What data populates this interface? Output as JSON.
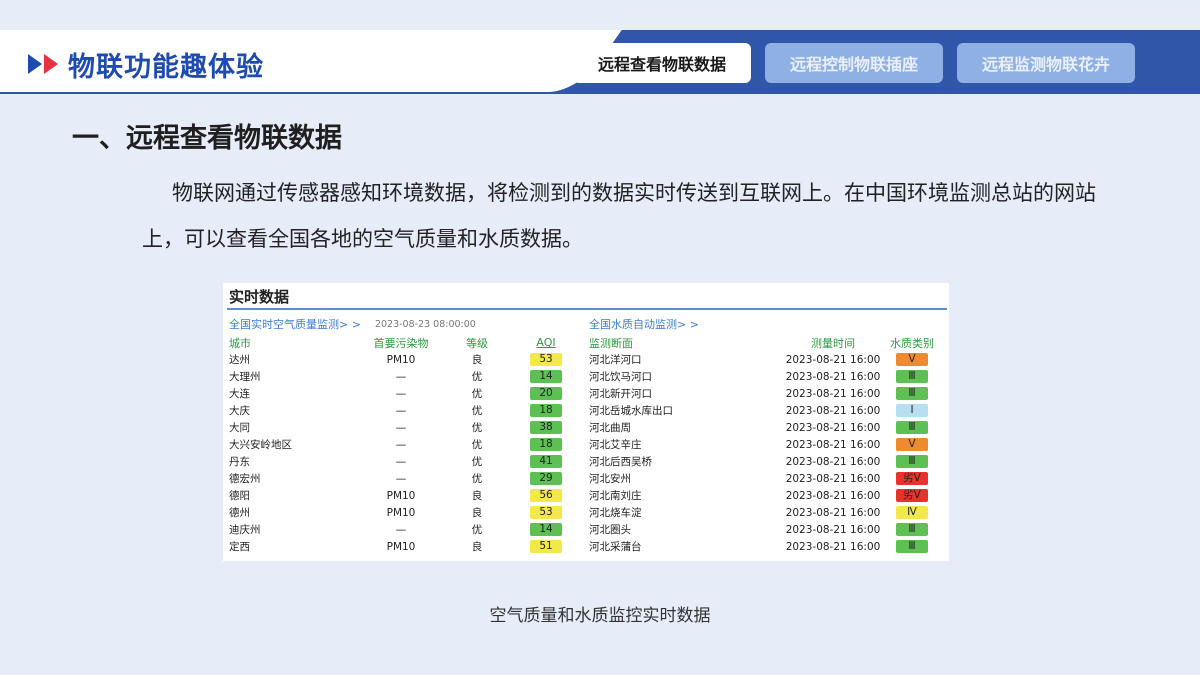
{
  "header": {
    "title": "物联功能趣体验",
    "tabs": [
      {
        "label": "远程查看物联数据",
        "active": true
      },
      {
        "label": "远程控制物联插座",
        "active": false
      },
      {
        "label": "远程监测物联花卉",
        "active": false
      }
    ]
  },
  "section": {
    "title": "一、远程查看物联数据",
    "paragraph": "物联网通过传感器感知环境数据，将检测到的数据实时传送到互联网上。在中国环境监测总站的网站上，可以查看全国各地的空气质量和水质数据。"
  },
  "panel": {
    "title": "实时数据",
    "air": {
      "link": "全国实时空气质量监测> >",
      "timestamp": "2023-08-23 08:00:00",
      "headers": {
        "city": "城市",
        "pollutant": "首要污染物",
        "level": "等级",
        "aqi": "AQI"
      },
      "rows": [
        {
          "city": "达州",
          "pollutant": "PM10",
          "level": "良",
          "aqi": "53",
          "color": "#f2e84a"
        },
        {
          "city": "大理州",
          "pollutant": "—",
          "level": "优",
          "aqi": "14",
          "color": "#5cc152"
        },
        {
          "city": "大连",
          "pollutant": "—",
          "level": "优",
          "aqi": "20",
          "color": "#5cc152"
        },
        {
          "city": "大庆",
          "pollutant": "—",
          "level": "优",
          "aqi": "18",
          "color": "#5cc152"
        },
        {
          "city": "大同",
          "pollutant": "—",
          "level": "优",
          "aqi": "38",
          "color": "#5cc152"
        },
        {
          "city": "大兴安岭地区",
          "pollutant": "—",
          "level": "优",
          "aqi": "18",
          "color": "#5cc152"
        },
        {
          "city": "丹东",
          "pollutant": "—",
          "level": "优",
          "aqi": "41",
          "color": "#5cc152"
        },
        {
          "city": "德宏州",
          "pollutant": "—",
          "level": "优",
          "aqi": "29",
          "color": "#5cc152"
        },
        {
          "city": "德阳",
          "pollutant": "PM10",
          "level": "良",
          "aqi": "56",
          "color": "#f2e84a"
        },
        {
          "city": "德州",
          "pollutant": "PM10",
          "level": "良",
          "aqi": "53",
          "color": "#f2e84a"
        },
        {
          "city": "迪庆州",
          "pollutant": "—",
          "level": "优",
          "aqi": "14",
          "color": "#5cc152"
        },
        {
          "city": "定西",
          "pollutant": "PM10",
          "level": "良",
          "aqi": "51",
          "color": "#f2e84a"
        }
      ]
    },
    "water": {
      "link": "全国水质自动监测> >",
      "headers": {
        "site": "监测断面",
        "time": "测量时间",
        "class": "水质类别"
      },
      "rows": [
        {
          "site": "河北洋河口",
          "time": "2023-08-21 16:00",
          "class": "Ⅴ",
          "color": "#f08a2e"
        },
        {
          "site": "河北饮马河口",
          "time": "2023-08-21 16:00",
          "class": "Ⅲ",
          "color": "#5cc152"
        },
        {
          "site": "河北新开河口",
          "time": "2023-08-21 16:00",
          "class": "Ⅲ",
          "color": "#5cc152"
        },
        {
          "site": "河北岳城水库出口",
          "time": "2023-08-21 16:00",
          "class": "Ⅰ",
          "color": "#b8dff0"
        },
        {
          "site": "河北曲周",
          "time": "2023-08-21 16:00",
          "class": "Ⅲ",
          "color": "#5cc152"
        },
        {
          "site": "河北艾辛庄",
          "time": "2023-08-21 16:00",
          "class": "Ⅴ",
          "color": "#f08a2e"
        },
        {
          "site": "河北后西吴桥",
          "time": "2023-08-21 16:00",
          "class": "Ⅲ",
          "color": "#5cc152"
        },
        {
          "site": "河北安州",
          "time": "2023-08-21 16:00",
          "class": "劣Ⅴ",
          "color": "#e8322e"
        },
        {
          "site": "河北南刘庄",
          "time": "2023-08-21 16:00",
          "class": "劣Ⅴ",
          "color": "#e8322e"
        },
        {
          "site": "河北烧车淀",
          "time": "2023-08-21 16:00",
          "class": "Ⅳ",
          "color": "#f2e84a"
        },
        {
          "site": "河北圈头",
          "time": "2023-08-21 16:00",
          "class": "Ⅲ",
          "color": "#5cc152"
        },
        {
          "site": "河北采蒲台",
          "time": "2023-08-21 16:00",
          "class": "Ⅲ",
          "color": "#5cc152"
        }
      ]
    }
  },
  "caption": "空气质量和水质监控实时数据",
  "colors": {
    "brand": "#1e4bb0",
    "accent": "#e3343f",
    "header_bar": "#2f56a8"
  }
}
